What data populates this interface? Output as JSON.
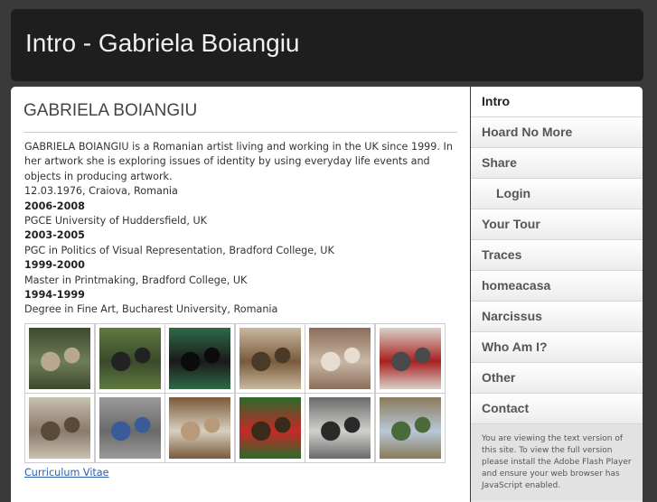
{
  "header": {
    "title": "Intro - Gabriela Boiangiu"
  },
  "main": {
    "heading": "GABRIELA BOIANGIU",
    "intro": "GABRIELA BOIANGIU is a Romanian artist living and working in the UK since 1999. In her artwork she is exploring issues of identity by using everyday life events and objects in producing artwork.",
    "birth": "12.03.1976, Craiova, Romania",
    "education": [
      {
        "years": "2006-2008",
        "detail": "PGCE University of Huddersfield, UK"
      },
      {
        "years": "2003-2005",
        "detail": "PGC in Politics of Visual Representation, Bradford College, UK"
      },
      {
        "years": "1999-2000",
        "detail": "Master in Printmaking, Bradford College, UK"
      },
      {
        "years": "1994-1999",
        "detail": "Degree in Fine Art, Bucharest University, Romania"
      }
    ],
    "thumbnails": [
      {
        "name": "thumb-1",
        "colors": [
          "#6e7d5a",
          "#3e4a2e",
          "#b8a890"
        ]
      },
      {
        "name": "thumb-2",
        "colors": [
          "#394a2a",
          "#5e7a40",
          "#222"
        ]
      },
      {
        "name": "thumb-3",
        "colors": [
          "#1a1a1a",
          "#2e6a48",
          "#0b0b0b"
        ]
      },
      {
        "name": "thumb-4",
        "colors": [
          "#7a5a3a",
          "#c8b8a0",
          "#4a3a28"
        ]
      },
      {
        "name": "thumb-5",
        "colors": [
          "#c9b7a5",
          "#8a6d5a",
          "#e8ddd0"
        ]
      },
      {
        "name": "thumb-6",
        "colors": [
          "#a82020",
          "#d8d0c8",
          "#4a4a4a"
        ]
      },
      {
        "name": "thumb-7",
        "colors": [
          "#8a7a6a",
          "#c8c0b0",
          "#5a4a3a"
        ]
      },
      {
        "name": "thumb-8",
        "colors": [
          "#6a6a6a",
          "#9a9a9a",
          "#3a5a9a"
        ]
      },
      {
        "name": "thumb-9",
        "colors": [
          "#d8cfc0",
          "#7a5a3a",
          "#b89a7a"
        ]
      },
      {
        "name": "thumb-10",
        "colors": [
          "#c82828",
          "#2a6a2a",
          "#3a2a1a"
        ]
      },
      {
        "name": "thumb-11",
        "colors": [
          "#d0d0cc",
          "#6a6a6a",
          "#2a2a2a"
        ]
      },
      {
        "name": "thumb-12",
        "colors": [
          "#b8c8d8",
          "#8a7a5a",
          "#4a6a3a"
        ]
      }
    ],
    "cv_link": "Curriculum Vitae"
  },
  "sidebar": {
    "items": [
      {
        "label": "Intro",
        "active": true,
        "sub": false
      },
      {
        "label": "Hoard No More",
        "active": false,
        "sub": false
      },
      {
        "label": "Share",
        "active": false,
        "sub": false
      },
      {
        "label": "Login",
        "active": false,
        "sub": true
      },
      {
        "label": "Your Tour",
        "active": false,
        "sub": false
      },
      {
        "label": "Traces",
        "active": false,
        "sub": false
      },
      {
        "label": "homeacasa",
        "active": false,
        "sub": false
      },
      {
        "label": "Narcissus",
        "active": false,
        "sub": false
      },
      {
        "label": "Who Am I?",
        "active": false,
        "sub": false
      },
      {
        "label": "Other",
        "active": false,
        "sub": false
      },
      {
        "label": "Contact",
        "active": false,
        "sub": false
      }
    ],
    "note": "You are viewing the text version of this site. To view the full version please install the Adobe Flash Player and ensure your web browser has JavaScript enabled."
  }
}
